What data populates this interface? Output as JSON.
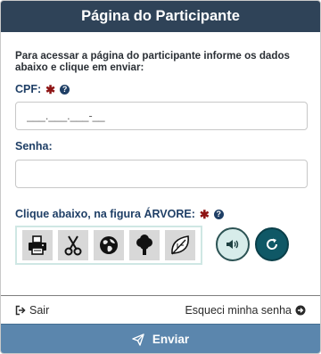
{
  "header": {
    "title": "Página do Participante"
  },
  "intro": {
    "text": "Para acessar a página do participante informe os dados abaixo e clique em enviar:"
  },
  "cpf": {
    "label": "CPF:",
    "placeholder": "___.___.___-__",
    "value": ""
  },
  "senha": {
    "label": "Senha:",
    "value": ""
  },
  "captcha": {
    "label": "Clique abaixo, na figura ÁRVORE:",
    "icons": [
      "printer-icon",
      "scissors-icon",
      "globe-icon",
      "tree-icon",
      "leaf-icon"
    ],
    "tile_bg": "#d8d8d8",
    "border_color": "#cfe7e4"
  },
  "required_mark": "✱",
  "help_mark": "?",
  "footer": {
    "sair_label": "Sair",
    "esqueci_label": "Esqueci minha senha",
    "submit_label": "Enviar"
  },
  "colors": {
    "header_bg": "#2f4358",
    "label": "#1f3f66",
    "required": "#8e1414",
    "submit_bg": "#5b86ad",
    "audio_bg": "#d7ecea",
    "refresh_bg": "#0f5866"
  }
}
